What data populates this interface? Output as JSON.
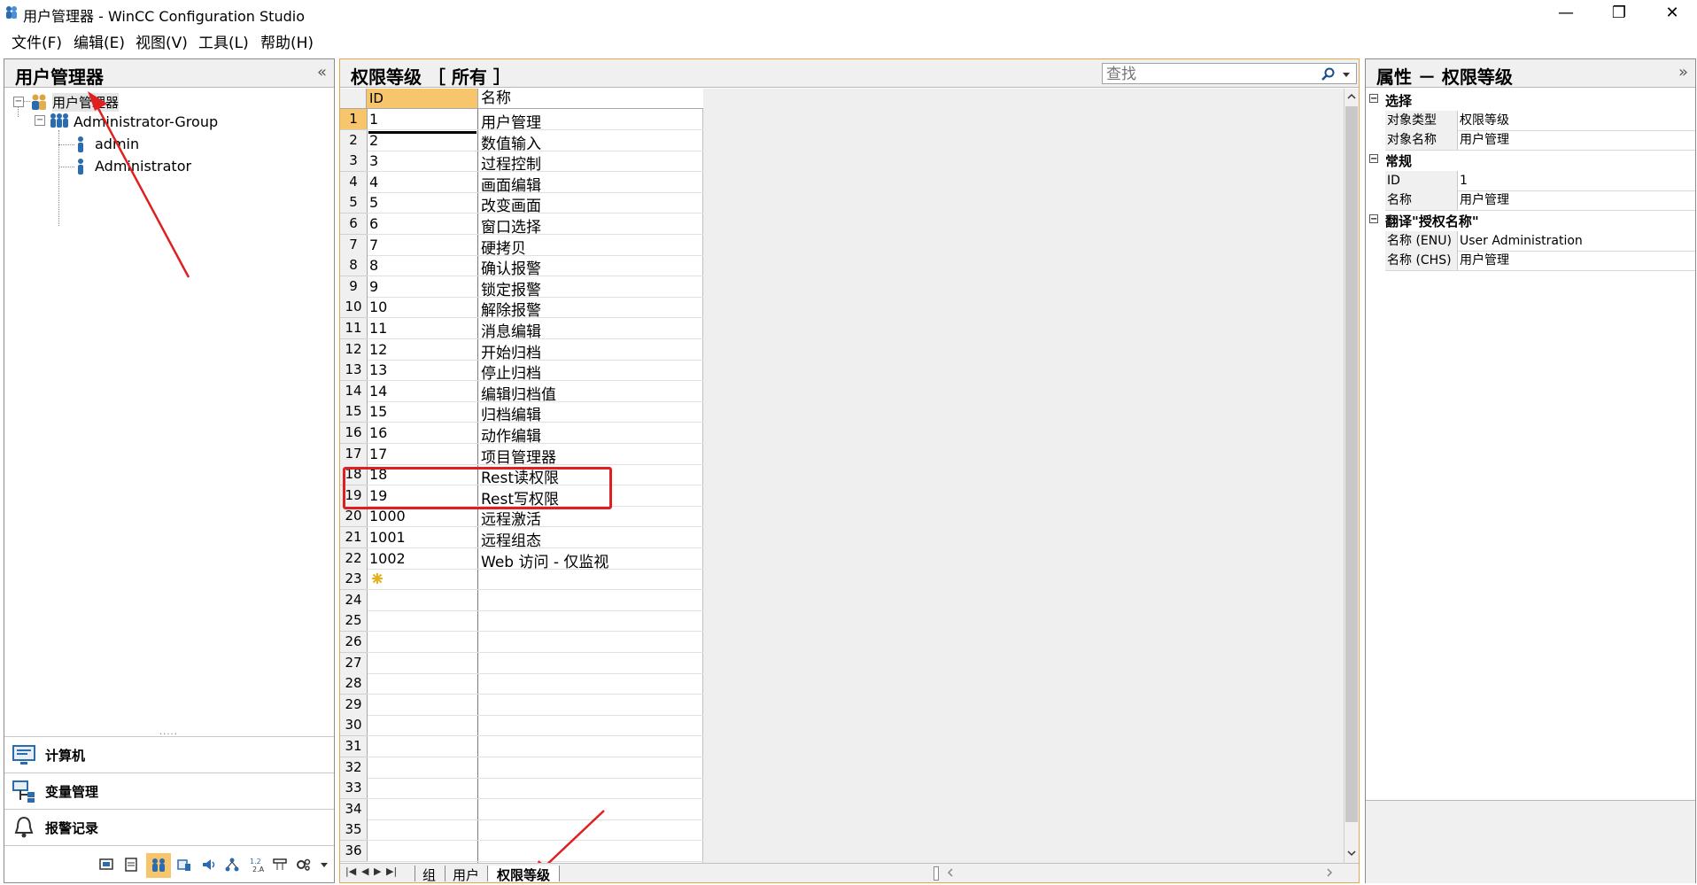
{
  "window": {
    "title": "用户管理器 - WinCC Configuration Studio",
    "minimize": "—",
    "restore": "❐",
    "close": "✕"
  },
  "menu": {
    "items": [
      "文件(F)",
      "编辑(E)",
      "视图(V)",
      "工具(L)",
      "帮助(H)"
    ]
  },
  "left_panel": {
    "title": "用户管理器",
    "collapse": "«",
    "tree": {
      "root": "用户管理器",
      "group": "Administrator-Group",
      "users": [
        "admin",
        "Administrator"
      ]
    },
    "nav": [
      "计算机",
      "变量管理",
      "报警记录"
    ],
    "grip": "....."
  },
  "center_panel": {
    "title": "权限等级 ［ 所有 ］",
    "search_placeholder": "查找",
    "columns": [
      "ID",
      "名称"
    ],
    "rows": [
      {
        "n": "1",
        "id": "1",
        "name": "用户管理"
      },
      {
        "n": "2",
        "id": "2",
        "name": "数值输入"
      },
      {
        "n": "3",
        "id": "3",
        "name": "过程控制"
      },
      {
        "n": "4",
        "id": "4",
        "name": "画面编辑"
      },
      {
        "n": "5",
        "id": "5",
        "name": "改变画面"
      },
      {
        "n": "6",
        "id": "6",
        "name": "窗口选择"
      },
      {
        "n": "7",
        "id": "7",
        "name": "硬拷贝"
      },
      {
        "n": "8",
        "id": "8",
        "name": "确认报警"
      },
      {
        "n": "9",
        "id": "9",
        "name": "锁定报警"
      },
      {
        "n": "10",
        "id": "10",
        "name": "解除报警"
      },
      {
        "n": "11",
        "id": "11",
        "name": "消息编辑"
      },
      {
        "n": "12",
        "id": "12",
        "name": "开始归档"
      },
      {
        "n": "13",
        "id": "13",
        "name": "停止归档"
      },
      {
        "n": "14",
        "id": "14",
        "name": "编辑归档值"
      },
      {
        "n": "15",
        "id": "15",
        "name": "归档编辑"
      },
      {
        "n": "16",
        "id": "16",
        "name": "动作编辑"
      },
      {
        "n": "17",
        "id": "17",
        "name": "项目管理器"
      },
      {
        "n": "18",
        "id": "18",
        "name": "Rest读权限"
      },
      {
        "n": "19",
        "id": "19",
        "name": "Rest写权限"
      },
      {
        "n": "20",
        "id": "1000",
        "name": "远程激活"
      },
      {
        "n": "21",
        "id": "1001",
        "name": "远程组态"
      },
      {
        "n": "22",
        "id": "1002",
        "name": "Web 访问 - 仅监视"
      },
      {
        "n": "23",
        "id": "",
        "name": ""
      },
      {
        "n": "24",
        "id": "",
        "name": ""
      },
      {
        "n": "25",
        "id": "",
        "name": ""
      },
      {
        "n": "26",
        "id": "",
        "name": ""
      },
      {
        "n": "27",
        "id": "",
        "name": ""
      },
      {
        "n": "28",
        "id": "",
        "name": ""
      },
      {
        "n": "29",
        "id": "",
        "name": ""
      },
      {
        "n": "30",
        "id": "",
        "name": ""
      },
      {
        "n": "31",
        "id": "",
        "name": ""
      },
      {
        "n": "32",
        "id": "",
        "name": ""
      },
      {
        "n": "33",
        "id": "",
        "name": ""
      },
      {
        "n": "34",
        "id": "",
        "name": ""
      },
      {
        "n": "35",
        "id": "",
        "name": ""
      },
      {
        "n": "36",
        "id": "",
        "name": ""
      }
    ],
    "tabs": [
      "组",
      "用户",
      "权限等级"
    ]
  },
  "right_panel": {
    "title": "属性 － 权限等级",
    "collapse": "»",
    "sections": [
      {
        "title": "选择",
        "rows": [
          {
            "key": "对象类型",
            "val": "权限等级"
          },
          {
            "key": "对象名称",
            "val": "用户管理"
          }
        ]
      },
      {
        "title": "常规",
        "rows": [
          {
            "key": "ID",
            "val": "1"
          },
          {
            "key": "名称",
            "val": "用户管理"
          }
        ]
      },
      {
        "title": "翻译\"授权名称\"",
        "rows": [
          {
            "key": "名称 (ENU)",
            "val": "User Administration"
          },
          {
            "key": "名称 (CHS)",
            "val": "用户管理"
          }
        ]
      }
    ]
  },
  "colors": {
    "accent_orange": "#e8a64a",
    "annotation_red": "#e02020",
    "selected_row": "#f7c56b"
  }
}
